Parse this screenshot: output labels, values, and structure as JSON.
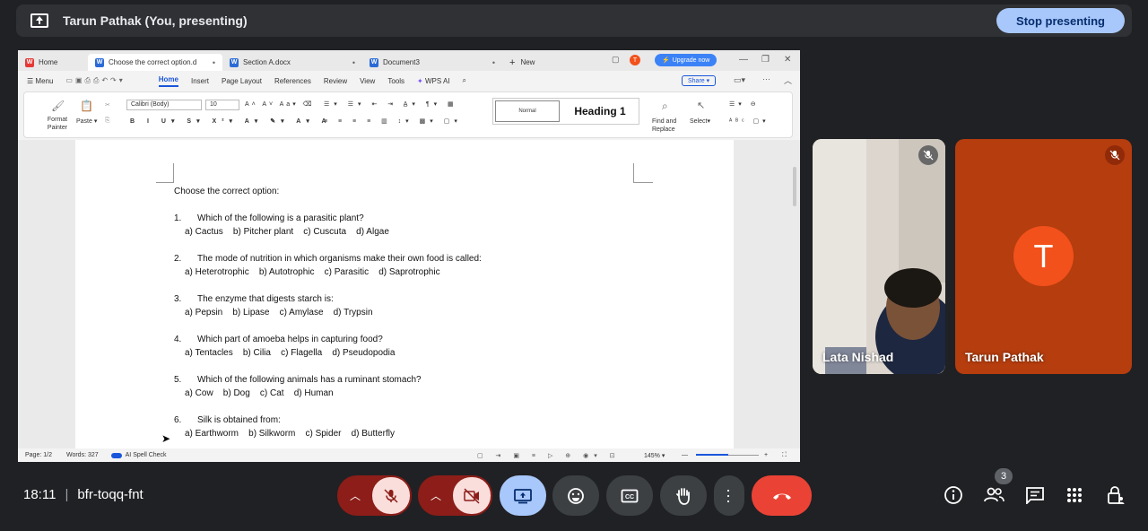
{
  "top_bar": {
    "presenting_title": "Tarun Pathak (You, presenting)",
    "stop_button": "Stop presenting"
  },
  "shared_screen": {
    "tabs": [
      {
        "label": "Home",
        "icon": "wps-home-icon",
        "color": "#e53935"
      },
      {
        "label": "Choose the correct option.d",
        "icon": "word-doc-icon",
        "color": "#2b6bd6"
      },
      {
        "label": "Section A.docx",
        "icon": "word-doc-icon",
        "color": "#2b6bd6"
      },
      {
        "label": "Document3",
        "icon": "word-doc-icon",
        "color": "#2b6bd6"
      }
    ],
    "new_tab": "New",
    "upgrade": "Upgrade now",
    "menu": {
      "menu": "Menu",
      "items": [
        "Home",
        "Insert",
        "Page Layout",
        "References",
        "Review",
        "View",
        "Tools"
      ],
      "wps_ai": "WPS AI",
      "share": "Share"
    },
    "ribbon": {
      "format_painter": "Format Painter",
      "paste": "Paste",
      "font": "Calibri (Body)",
      "size": "10",
      "style_normal": "Normal",
      "style_heading": "Heading 1",
      "find_replace": "Find and Replace",
      "select": "Select"
    },
    "document": {
      "heading": "Choose the correct option:",
      "questions": [
        {
          "num": "1.",
          "q": "Which of the following is a parasitic plant?",
          "opts": "a) Cactus    b) Pitcher plant    c) Cuscuta    d) Algae"
        },
        {
          "num": "2.",
          "q": "The mode of nutrition in which organisms make their own food is called:",
          "opts": "a) Heterotrophic    b) Autotrophic    c) Parasitic    d) Saprotrophic"
        },
        {
          "num": "3.",
          "q": "The enzyme that digests starch is:",
          "opts": "a) Pepsin    b) Lipase    c) Amylase    d) Trypsin"
        },
        {
          "num": "4.",
          "q": "Which part of amoeba helps in capturing food?",
          "opts": "a) Tentacles    b) Cilia    c) Flagella    d) Pseudopodia"
        },
        {
          "num": "5.",
          "q": "Which of the following animals has a ruminant stomach?",
          "opts": "a) Cow    b) Dog    c) Cat    d) Human"
        },
        {
          "num": "6.",
          "q": "Silk is obtained from:",
          "opts": "a) Earthworm    b) Silkworm    c) Spider    d) Butterfly"
        }
      ]
    },
    "status": {
      "page": "Page: 1/2",
      "words": "Words: 327",
      "spell": "AI Spell Check",
      "zoom": "145%"
    }
  },
  "participants": [
    {
      "name": "Lata Nishad",
      "muted": true
    },
    {
      "name": "Tarun Pathak",
      "initial": "T",
      "muted": true
    }
  ],
  "bottom_bar": {
    "time": "18:11",
    "meeting_code": "bfr-toqq-fnt",
    "people_count": "3"
  },
  "colors": {
    "background": "#202124",
    "stop_button_bg": "#a8c7fa",
    "end_call": "#ea4335",
    "avatar": "#f2511b"
  }
}
